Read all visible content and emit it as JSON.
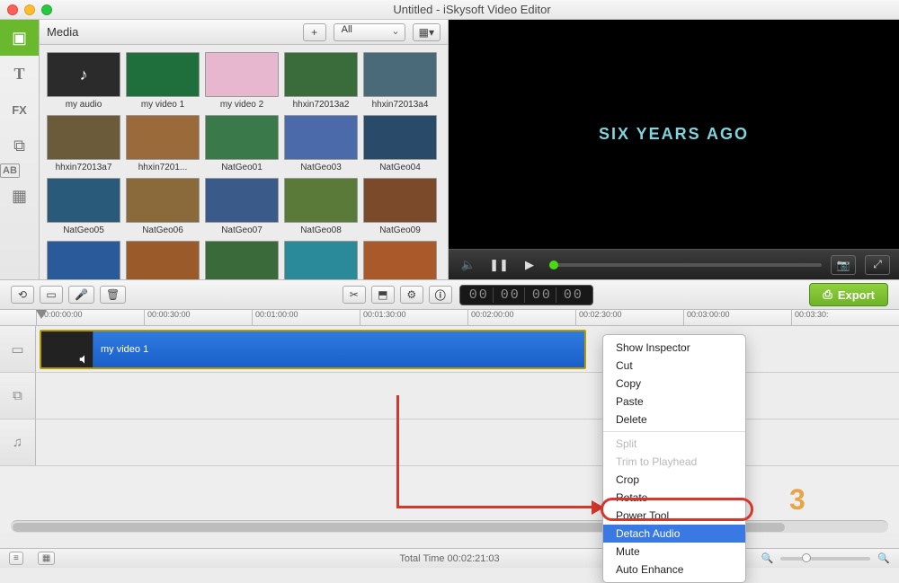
{
  "window": {
    "title": "Untitled - iSkysoft Video Editor"
  },
  "sidebar": {
    "items": [
      {
        "icon": "media-icon",
        "active": true
      },
      {
        "icon": "text-icon"
      },
      {
        "icon": "fx-icon"
      },
      {
        "icon": "pip-icon"
      },
      {
        "icon": "caption-icon"
      },
      {
        "icon": "transition-icon"
      }
    ]
  },
  "media": {
    "header": "Media",
    "add_label": "+",
    "filter_label": "All",
    "clips": [
      {
        "name": "my audio",
        "color": "#2b2b2b"
      },
      {
        "name": "my video 1",
        "color": "#1f6f3d"
      },
      {
        "name": "my video 2",
        "color": "#e7b7cf"
      },
      {
        "name": "hhxin72013a2",
        "color": "#3a6b3a"
      },
      {
        "name": "hhxin72013a4",
        "color": "#4a6a7a"
      },
      {
        "name": "hhxin72013a7",
        "color": "#6b5b3a"
      },
      {
        "name": "hhxin7201...",
        "color": "#9a6a3a"
      },
      {
        "name": "NatGeo01",
        "color": "#3a7a4a"
      },
      {
        "name": "NatGeo03",
        "color": "#4a6aaa"
      },
      {
        "name": "NatGeo04",
        "color": "#2a4a6a"
      },
      {
        "name": "NatGeo05",
        "color": "#2a5a7a"
      },
      {
        "name": "NatGeo06",
        "color": "#8a6a3a"
      },
      {
        "name": "NatGeo07",
        "color": "#3a5a8a"
      },
      {
        "name": "NatGeo08",
        "color": "#5a7a3a"
      },
      {
        "name": "NatGeo09",
        "color": "#7a4a2a"
      },
      {
        "name": "",
        "color": "#2a5a9a"
      },
      {
        "name": "",
        "color": "#9a5a2a"
      },
      {
        "name": "",
        "color": "#3a6a3a"
      },
      {
        "name": "",
        "color": "#2a8a9a"
      },
      {
        "name": "",
        "color": "#aa5a2a"
      }
    ]
  },
  "preview": {
    "overlay_text": "SIX YEARS AGO"
  },
  "timecode": [
    "00",
    "00",
    "00",
    "00"
  ],
  "export_label": "Export",
  "ruler_ticks": [
    "00:00:00:00",
    "00:00:30:00",
    "00:01:00:00",
    "00:01:30:00",
    "00:02:00:00",
    "00:02:30:00",
    "00:03:00:00",
    "00:03:30:"
  ],
  "timeline": {
    "clip_label": "my video 1"
  },
  "context_menu": {
    "items": [
      {
        "label": "Show Inspector",
        "state": ""
      },
      {
        "label": "Cut",
        "state": ""
      },
      {
        "label": "Copy",
        "state": ""
      },
      {
        "label": "Paste",
        "state": ""
      },
      {
        "label": "Delete",
        "state": ""
      },
      {
        "sep": true
      },
      {
        "label": "Split",
        "state": "disabled"
      },
      {
        "label": "Trim to Playhead",
        "state": "disabled"
      },
      {
        "label": "Crop",
        "state": ""
      },
      {
        "label": "Rotate",
        "state": ""
      },
      {
        "label": "Power Tool",
        "state": ""
      },
      {
        "label": "Detach Audio",
        "state": "sel"
      },
      {
        "label": "Mute",
        "state": ""
      },
      {
        "label": "Auto Enhance",
        "state": ""
      }
    ]
  },
  "annotation": {
    "step": "3"
  },
  "status": {
    "total": "Total Time 00:02:21:03"
  }
}
